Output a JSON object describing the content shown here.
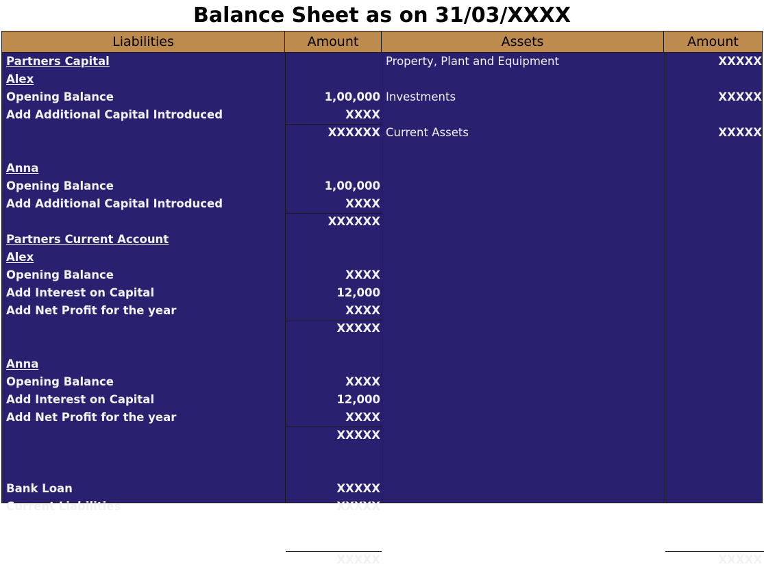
{
  "document": {
    "title": "Balance Sheet as on 31/03/XXXX"
  },
  "colors": {
    "header_background": "#BE8B4F",
    "body_background": "#2A2070",
    "text": "#F2F2F2",
    "title_text": "#000000",
    "grid_line": "#1A1A1A"
  },
  "table": {
    "headers": {
      "liabilities": "Liabilities",
      "amount_left": "Amount",
      "assets": "Assets",
      "amount_right": "Amount"
    },
    "liabilities": [
      {
        "label": "Partners Capital",
        "amount": "",
        "style": "heading-underline"
      },
      {
        "label": "Alex",
        "amount": "",
        "style": "name-underline"
      },
      {
        "label": "Opening Balance",
        "amount": "1,00,000",
        "style": "item"
      },
      {
        "label": "Add Additional Capital Introduced",
        "amount": "XXXX",
        "style": "item"
      },
      {
        "label": "",
        "amount": "XXXXXX",
        "style": "subtotal"
      },
      {
        "label": "Anna",
        "amount": "",
        "style": "name-underline"
      },
      {
        "label": "Opening Balance",
        "amount": "1,00,000",
        "style": "item"
      },
      {
        "label": "Add Additional Capital Introduced",
        "amount": "XXXX",
        "style": "item"
      },
      {
        "label": "",
        "amount": "XXXXXX",
        "style": "subtotal"
      },
      {
        "label": "Partners Current Account",
        "amount": "",
        "style": "heading-underline"
      },
      {
        "label": "Alex",
        "amount": "",
        "style": "name-underline"
      },
      {
        "label": "Opening Balance",
        "amount": "XXXX",
        "style": "item"
      },
      {
        "label": "Add Interest on Capital",
        "amount": "12,000",
        "style": "item"
      },
      {
        "label": "Add Net Profit for the year",
        "amount": "XXXX",
        "style": "item"
      },
      {
        "label": "",
        "amount": "XXXXX",
        "style": "subtotal"
      },
      {
        "label": "Anna",
        "amount": "",
        "style": "name-underline"
      },
      {
        "label": "Opening Balance",
        "amount": "XXXX",
        "style": "item"
      },
      {
        "label": "Add Interest on Capital",
        "amount": "12,000",
        "style": "item"
      },
      {
        "label": "Add Net Profit for the year",
        "amount": "XXXX",
        "style": "item"
      },
      {
        "label": "",
        "amount": "XXXXX",
        "style": "subtotal"
      },
      {
        "label": "Bank Loan",
        "amount": "XXXXX",
        "style": "item"
      },
      {
        "label": "Current Liabilities",
        "amount": "XXXXX",
        "style": "item"
      }
    ],
    "liabilities_total": {
      "label": "",
      "amount": "XXXXX"
    },
    "assets": [
      {
        "label": "Property, Plant and Equipment",
        "amount": "XXXXX"
      },
      {
        "label": "Investments",
        "amount": "XXXXX"
      },
      {
        "label": "Current Assets",
        "amount": "XXXXX"
      }
    ],
    "assets_total": {
      "label": "",
      "amount": "XXXXX"
    }
  }
}
